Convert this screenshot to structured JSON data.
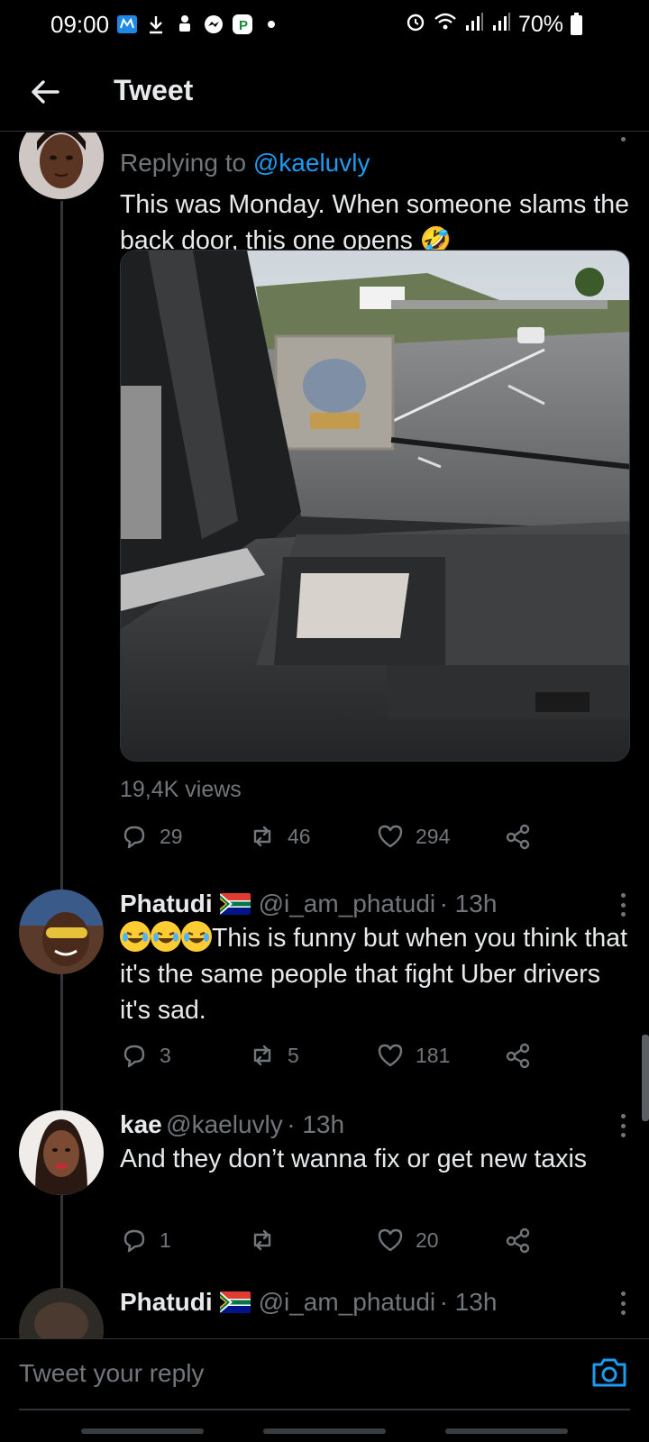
{
  "status_bar": {
    "time": "09:00",
    "battery": "70%",
    "left_icons": [
      "showmax-icon",
      "download-icon",
      "android-icon",
      "messenger-icon",
      "parking-app-icon",
      "dot-icon"
    ],
    "right_icons": [
      "alarm-icon",
      "wifi-icon",
      "signal-icon",
      "signal-icon"
    ]
  },
  "header": {
    "title": "Tweet"
  },
  "main_tweet": {
    "replying_label": "Replying to",
    "replying_to": "@kaeluvly",
    "text": "This was Monday. When someone slams the back door, this one opens 🤣",
    "views": "19,4K views",
    "replies": "29",
    "retweets": "46",
    "likes": "294"
  },
  "replies": [
    {
      "name": "Phatudi",
      "handle": "@i_am_phatudi",
      "time": "· 13h",
      "text": "This is funny but when you think that it's the same people that fight Uber drivers it's sad.",
      "emoji_count": 3,
      "replies": "3",
      "retweets": "5",
      "likes": "181"
    },
    {
      "name": "kae",
      "handle": "@kaeluvly",
      "time": "· 13h",
      "text": "And they don’t wanna fix or get new taxis",
      "replies": "1",
      "retweets": "",
      "likes": "20"
    },
    {
      "name": "Phatudi",
      "handle": "@i_am_phatudi",
      "time": "· 13h"
    }
  ],
  "reply_bar": {
    "placeholder": "Tweet your reply"
  },
  "colors": {
    "background": "#000000",
    "text": "#e7e9ea",
    "muted": "#71767b",
    "accent": "#1d9bf0",
    "divider": "#2f3336"
  }
}
